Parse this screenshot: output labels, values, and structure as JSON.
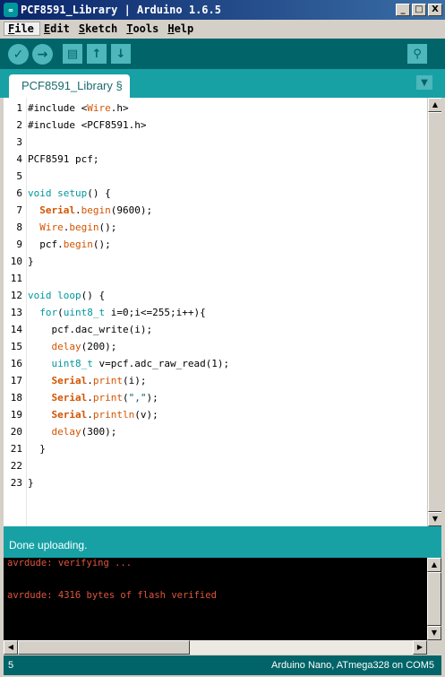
{
  "window": {
    "title": "PCF8591_Library | Arduino 1.6.5",
    "minimize": "_",
    "maximize": "□",
    "close": "X"
  },
  "menu": [
    {
      "key": "F",
      "rest": "ile"
    },
    {
      "key": "E",
      "rest": "dit"
    },
    {
      "key": "S",
      "rest": "ketch"
    },
    {
      "key": "T",
      "rest": "ools"
    },
    {
      "key": "H",
      "rest": "elp"
    }
  ],
  "toolbar": {
    "verify": "✓",
    "upload": "→",
    "new": "▤",
    "open": "↑",
    "save": "↓",
    "serial_monitor": "⚲"
  },
  "tab": {
    "label": "PCF8591_Library §",
    "menu_icon": "▼"
  },
  "editor": {
    "lines": [
      {
        "n": "1",
        "html": "#include &lt;<span class='cls'>Wire</span>.h&gt;"
      },
      {
        "n": "2",
        "html": "#include &lt;PCF8591.h&gt;"
      },
      {
        "n": "3",
        "html": ""
      },
      {
        "n": "4",
        "html": "PCF8591 pcf;"
      },
      {
        "n": "5",
        "html": ""
      },
      {
        "n": "6",
        "html": "<span class='kw'>void</span> <span class='kw'>setup</span>() {"
      },
      {
        "n": "7",
        "html": "  <span class='obj'>Serial</span>.<span class='fn'>begin</span>(9600);"
      },
      {
        "n": "8",
        "html": "  <span class='cls'>Wire</span>.<span class='fn'>begin</span>();"
      },
      {
        "n": "9",
        "html": "  pcf.<span class='fn'>begin</span>();"
      },
      {
        "n": "10",
        "html": "}"
      },
      {
        "n": "11",
        "html": ""
      },
      {
        "n": "12",
        "html": "<span class='kw'>void</span> <span class='kw'>loop</span>() {"
      },
      {
        "n": "13",
        "html": "  <span class='kw'>for</span>(<span class='ty'>uint8_t</span> i=0;i&lt;=255;i++){"
      },
      {
        "n": "14",
        "html": "    pcf.dac_write(i);"
      },
      {
        "n": "15",
        "html": "    <span class='fn'>delay</span>(200);"
      },
      {
        "n": "16",
        "html": "    <span class='ty'>uint8_t</span> v=pcf.adc_raw_read(1);"
      },
      {
        "n": "17",
        "html": "    <span class='obj'>Serial</span>.<span class='fn'>print</span>(i);"
      },
      {
        "n": "18",
        "html": "    <span class='obj'>Serial</span>.<span class='fn'>print</span>(<span class='str'>\",\"</span>);"
      },
      {
        "n": "19",
        "html": "    <span class='obj'>Serial</span>.<span class='fn'>println</span>(v);"
      },
      {
        "n": "20",
        "html": "    <span class='fn'>delay</span>(300);"
      },
      {
        "n": "21",
        "html": "  }"
      },
      {
        "n": "22",
        "html": ""
      },
      {
        "n": "23",
        "html": "}"
      }
    ]
  },
  "status": {
    "message": "Done uploading."
  },
  "console": {
    "lines": [
      "avrdude: verifying ...",
      "",
      "avrdude: 4316 bytes of flash verified"
    ]
  },
  "footer": {
    "line": "5",
    "board": "Arduino Nano, ATmega328 on COM5"
  }
}
